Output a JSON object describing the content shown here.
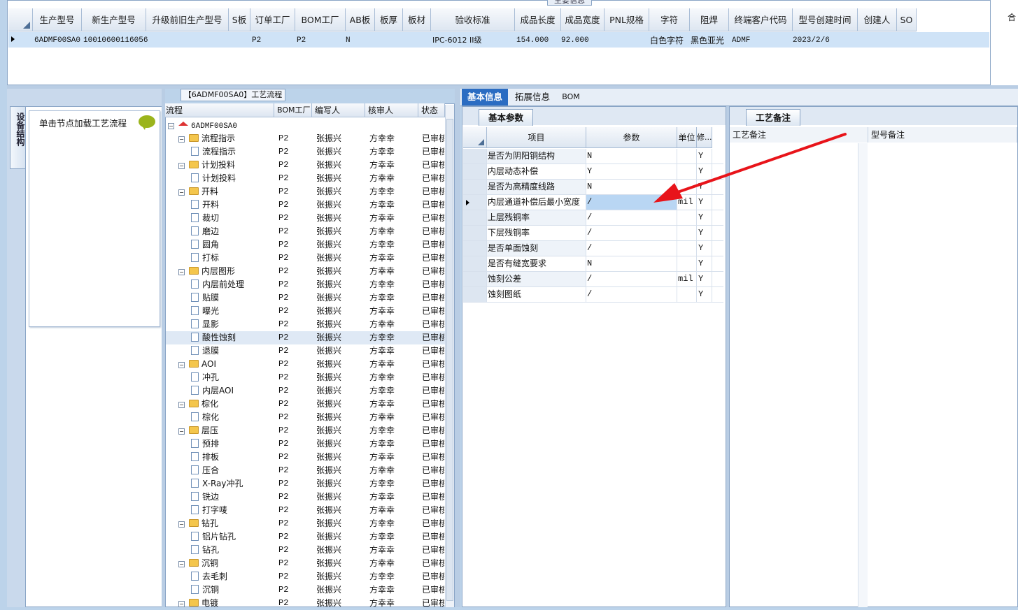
{
  "top": {
    "title": "主要信息",
    "columns": [
      "生产型号",
      "新生产型号",
      "升级前旧生产型号",
      "S板",
      "订单工厂",
      "BOM工厂",
      "AB板",
      "板厚",
      "板材",
      "验收标准",
      "成品长度",
      "成品宽度",
      "PNL规格",
      "字符",
      "阻焊",
      "终端客户代码",
      "型号创建时间",
      "创建人",
      "SO"
    ],
    "row": {
      "prod_model": "6ADMF00SA0",
      "new_model": "10010600116056",
      "order_factory": "P2",
      "bom_factory": "P2",
      "ab_board": "N",
      "standard": "IPC-6012 II级",
      "length": "154.000",
      "width": "92.000",
      "char": "白色字符",
      "mask": "黑色亚光",
      "customer": "ADMF",
      "created": "2023/2/6"
    },
    "right_stub": "合"
  },
  "left": {
    "tab_label": "设备结构",
    "node_hint": "单击节点加载工艺流程"
  },
  "tree": {
    "title": "【6ADMF00SA0】工艺流程",
    "columns": [
      "流程",
      "BOM工厂",
      "编写人",
      "核审人",
      "状态"
    ],
    "root": "6ADMF00SA0",
    "rows": [
      {
        "name": "流程指示",
        "folder": true
      },
      {
        "name": "流程指示",
        "folder": false
      },
      {
        "name": "计划投料",
        "folder": true
      },
      {
        "name": "计划投料",
        "folder": false
      },
      {
        "name": "开料",
        "folder": true
      },
      {
        "name": "开料",
        "folder": false
      },
      {
        "name": "裁切",
        "folder": false
      },
      {
        "name": "磨边",
        "folder": false
      },
      {
        "name": "圆角",
        "folder": false
      },
      {
        "name": "打标",
        "folder": false
      },
      {
        "name": "内层图形",
        "folder": true
      },
      {
        "name": "内层前处理",
        "folder": false
      },
      {
        "name": "贴膜",
        "folder": false
      },
      {
        "name": "曝光",
        "folder": false
      },
      {
        "name": "显影",
        "folder": false
      },
      {
        "name": "酸性蚀刻",
        "folder": false,
        "selected": true
      },
      {
        "name": "退膜",
        "folder": false
      },
      {
        "name": "AOI",
        "folder": true
      },
      {
        "name": "冲孔",
        "folder": false
      },
      {
        "name": "内层AOI",
        "folder": false
      },
      {
        "name": "棕化",
        "folder": true
      },
      {
        "name": "棕化",
        "folder": false
      },
      {
        "name": "层压",
        "folder": true
      },
      {
        "name": "预排",
        "folder": false
      },
      {
        "name": "排板",
        "folder": false
      },
      {
        "name": "压合",
        "folder": false
      },
      {
        "name": "X-Ray冲孔",
        "folder": false
      },
      {
        "name": "铣边",
        "folder": false
      },
      {
        "name": "打字唛",
        "folder": false
      },
      {
        "name": "钻孔",
        "folder": true
      },
      {
        "name": "铝片钻孔",
        "folder": false
      },
      {
        "name": "钻孔",
        "folder": false
      },
      {
        "name": "沉铜",
        "folder": true
      },
      {
        "name": "去毛刺",
        "folder": false
      },
      {
        "name": "沉铜",
        "folder": false
      },
      {
        "name": "电镀",
        "folder": true
      }
    ],
    "bom": "P2",
    "writer": "张振兴",
    "reviewer": "方幸幸",
    "status": "已审核"
  },
  "tabs": [
    "基本信息",
    "拓展信息",
    "BOM"
  ],
  "basic": {
    "tab": "基本参数",
    "columns": [
      "项目",
      "参数",
      "单位",
      "修..."
    ],
    "rows": [
      {
        "item": "是否为阴阳铜结构",
        "param": "N",
        "unit": "",
        "mod": "Y"
      },
      {
        "item": "内层动态补偿",
        "param": "Y",
        "unit": "",
        "mod": "Y"
      },
      {
        "item": "是否为高精度线路",
        "param": "N",
        "unit": "",
        "mod": "Y"
      },
      {
        "item": "内层通道补偿后最小宽度",
        "param": "/",
        "unit": "mil",
        "mod": "Y"
      },
      {
        "item": "上层残铜率",
        "param": "/",
        "unit": "",
        "mod": "Y"
      },
      {
        "item": "下层残铜率",
        "param": "/",
        "unit": "",
        "mod": "Y"
      },
      {
        "item": "是否单面蚀刻",
        "param": "/",
        "unit": "",
        "mod": "Y"
      },
      {
        "item": "是否有缝宽要求",
        "param": "N",
        "unit": "",
        "mod": "Y"
      },
      {
        "item": "蚀刻公差",
        "param": "/",
        "unit": "mil",
        "mod": "Y"
      },
      {
        "item": "蚀刻图纸",
        "param": "/",
        "unit": "",
        "mod": "Y"
      }
    ]
  },
  "notes": {
    "tab": "工艺备注",
    "col1": "工艺备注",
    "col2": "型号备注"
  },
  "annotation": {
    "arrow_color": "#e8141a"
  }
}
